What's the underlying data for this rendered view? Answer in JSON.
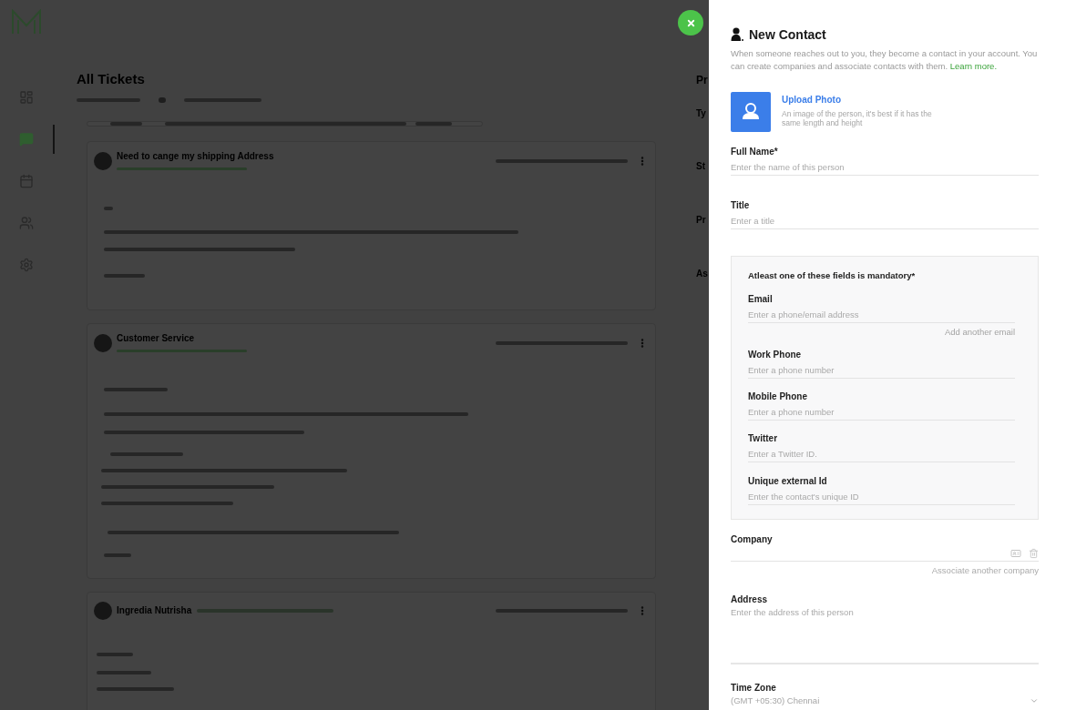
{
  "sidebar": {
    "items": [
      {
        "selected": false
      },
      {
        "selected": true
      },
      {
        "selected": false
      },
      {
        "selected": false
      },
      {
        "selected": false
      }
    ]
  },
  "tickets_page": {
    "title": "All Tickets",
    "tickets": [
      {
        "title": "Need to cange my shipping Address"
      },
      {
        "title": "Customer Service"
      },
      {
        "title": "Ingredia Nutrisha"
      }
    ],
    "side_labels": [
      "Pr",
      "Ty",
      "St",
      "Pr",
      "As"
    ]
  },
  "drawer": {
    "title": "New Contact",
    "description": "When someone reaches out to you, they become a contact in your account. You can create companies and associate contacts with them.",
    "learn_more": "Learn more.",
    "upload": {
      "label": "Upload Photo",
      "hint": "An image of the person, it's best if it has the same length and height"
    },
    "fields": [
      {
        "label": "Full Name*",
        "placeholder": "Enter the name of this person"
      },
      {
        "label": "Title",
        "placeholder": "Enter a title"
      }
    ],
    "mandatory_group": {
      "heading": "Atleast one of these fields is mandatory*",
      "fields": [
        {
          "label": "Email",
          "placeholder": "Enter a phone/email address",
          "action": "Add another email"
        },
        {
          "label": "Work Phone",
          "placeholder": "Enter a phone number"
        },
        {
          "label": "Mobile Phone",
          "placeholder": "Enter a phone number"
        },
        {
          "label": "Twitter",
          "placeholder": "Enter a Twitter ID."
        },
        {
          "label": "Unique external Id",
          "placeholder": "Enter the contact's unique ID"
        }
      ]
    },
    "company": {
      "label": "Company",
      "action": "Associate another company"
    },
    "address": {
      "label": "Address",
      "placeholder": "Enter the address of this person"
    },
    "time_zone": {
      "label": "Time Zone",
      "value": "(GMT +05:30) Chennai"
    }
  }
}
